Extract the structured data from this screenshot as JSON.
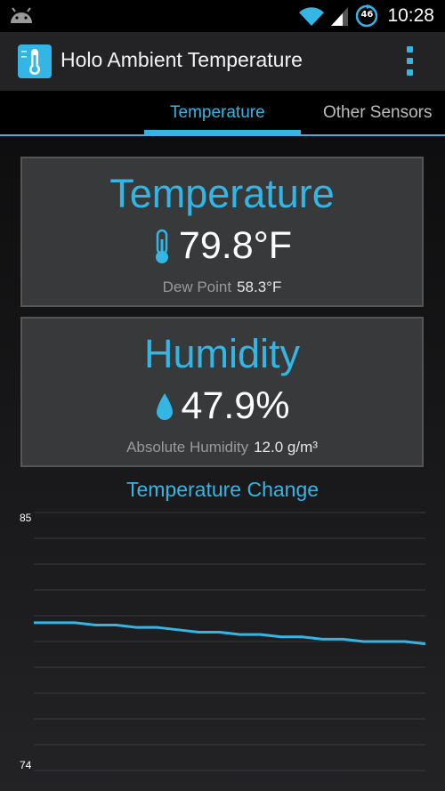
{
  "status_bar": {
    "time": "10:28",
    "network_badge": "46",
    "icons": [
      "android-icon",
      "wifi-icon",
      "signal-icon",
      "data-sync-icon"
    ]
  },
  "action_bar": {
    "title": "Holo Ambient Temperature",
    "app_icon": "thermometer-app-icon",
    "overflow_icon": "overflow-menu-icon"
  },
  "tabs": [
    {
      "label": "Temperature",
      "selected": true
    },
    {
      "label": "Other Sensors",
      "selected": false
    }
  ],
  "temperature_card": {
    "title": "Temperature",
    "value": "79.8°F",
    "icon": "thermometer-icon",
    "sub_label": "Dew Point",
    "sub_value": "58.3°F"
  },
  "humidity_card": {
    "title": "Humidity",
    "value": "47.9%",
    "icon": "water-drop-icon",
    "sub_label": "Absolute Humidity",
    "sub_value": "12.0 g/m³"
  },
  "chart_data": {
    "type": "line",
    "title": "Temperature Change",
    "ylim": [
      74,
      85
    ],
    "y_tick_labels": [
      "85",
      "74"
    ],
    "grid": true,
    "series": [
      {
        "values": [
          80.3,
          80.3,
          80.3,
          80.2,
          80.2,
          80.1,
          80.1,
          80.0,
          79.9,
          79.9,
          79.8,
          79.8,
          79.7,
          79.7,
          79.6,
          79.6,
          79.5,
          79.5,
          79.5,
          79.4
        ]
      }
    ],
    "colors": {
      "line": "#33b5e5",
      "grid": "#3a3b3e"
    }
  },
  "colors": {
    "accent": "#33b5e5",
    "card": "#38393b"
  }
}
